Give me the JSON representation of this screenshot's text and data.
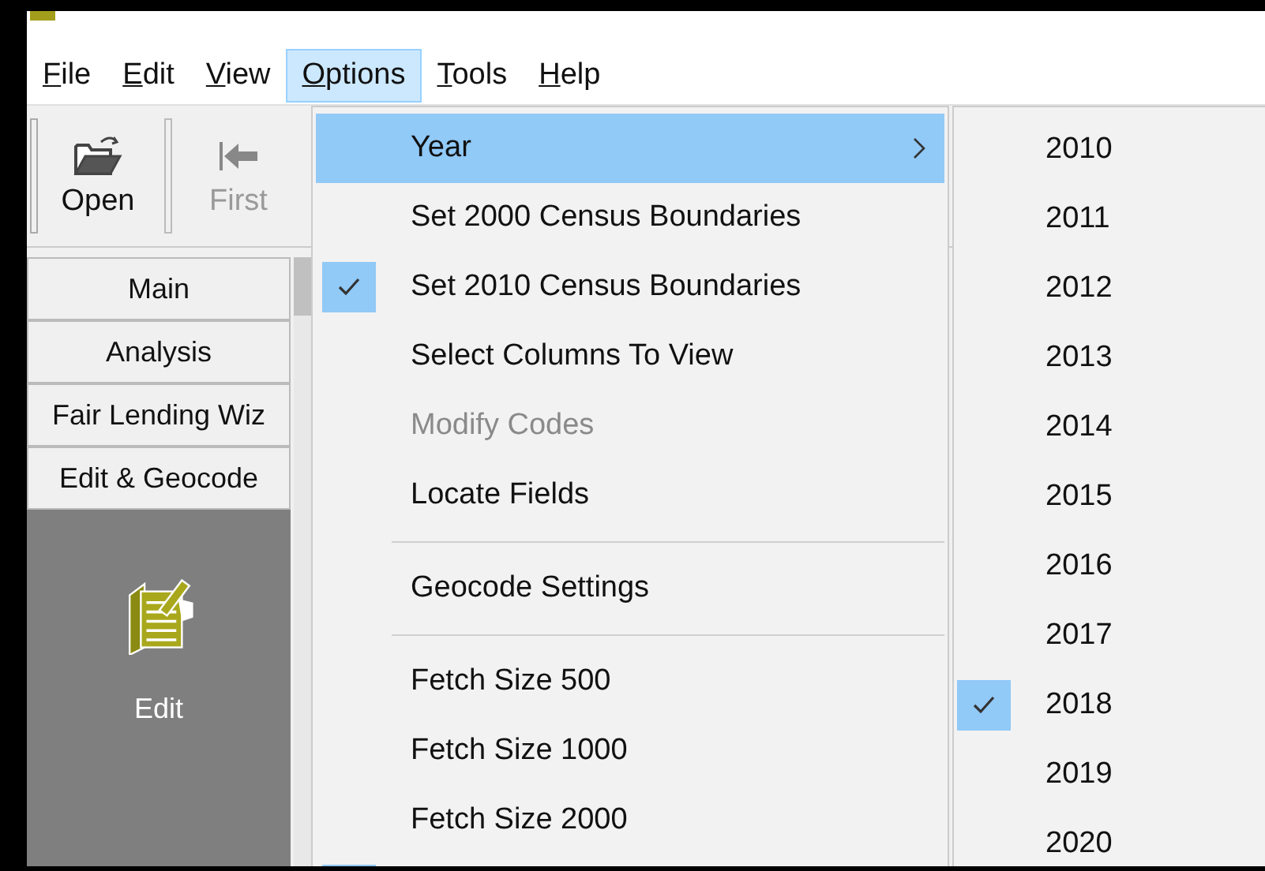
{
  "menubar": [
    {
      "label": "File",
      "selected": false
    },
    {
      "label": "Edit",
      "selected": false
    },
    {
      "label": "View",
      "selected": false
    },
    {
      "label": "Options",
      "selected": true
    },
    {
      "label": "Tools",
      "selected": false
    },
    {
      "label": "Help",
      "selected": false
    }
  ],
  "toolbar": [
    {
      "label": "Open",
      "disabled": false
    },
    {
      "label": "First",
      "disabled": true
    }
  ],
  "nav_buttons": [
    "Main",
    "Analysis",
    "Fair Lending Wiz",
    "Edit & Geocode"
  ],
  "nav_panel": {
    "label": "Edit"
  },
  "options_menu": [
    {
      "kind": "item",
      "label": "Year",
      "submenu": true,
      "selected": true,
      "checked": false,
      "disabled": false
    },
    {
      "kind": "item",
      "label": "Set 2000 Census Boundaries",
      "submenu": false,
      "selected": false,
      "checked": false,
      "disabled": false
    },
    {
      "kind": "item",
      "label": "Set 2010 Census Boundaries",
      "submenu": false,
      "selected": false,
      "checked": true,
      "disabled": false
    },
    {
      "kind": "item",
      "label": "Select Columns To View",
      "submenu": false,
      "selected": false,
      "checked": false,
      "disabled": false
    },
    {
      "kind": "item",
      "label": "Modify Codes",
      "submenu": false,
      "selected": false,
      "checked": false,
      "disabled": true
    },
    {
      "kind": "item",
      "label": "Locate Fields",
      "submenu": false,
      "selected": false,
      "checked": false,
      "disabled": false
    },
    {
      "kind": "separator"
    },
    {
      "kind": "item",
      "label": "Geocode Settings",
      "submenu": false,
      "selected": false,
      "checked": false,
      "disabled": false
    },
    {
      "kind": "separator"
    },
    {
      "kind": "item",
      "label": "Fetch Size 500",
      "submenu": false,
      "selected": false,
      "checked": false,
      "disabled": false
    },
    {
      "kind": "item",
      "label": "Fetch Size 1000",
      "submenu": false,
      "selected": false,
      "checked": false,
      "disabled": false
    },
    {
      "kind": "item",
      "label": "Fetch Size 2000",
      "submenu": false,
      "selected": false,
      "checked": false,
      "disabled": false
    },
    {
      "kind": "partial",
      "checked": true
    }
  ],
  "year_submenu": [
    {
      "label": "2010",
      "checked": false
    },
    {
      "label": "2011",
      "checked": false
    },
    {
      "label": "2012",
      "checked": false
    },
    {
      "label": "2013",
      "checked": false
    },
    {
      "label": "2014",
      "checked": false
    },
    {
      "label": "2015",
      "checked": false
    },
    {
      "label": "2016",
      "checked": false
    },
    {
      "label": "2017",
      "checked": false
    },
    {
      "label": "2018",
      "checked": true
    },
    {
      "label": "2019",
      "checked": false
    },
    {
      "label": "2020",
      "checked": false
    }
  ]
}
